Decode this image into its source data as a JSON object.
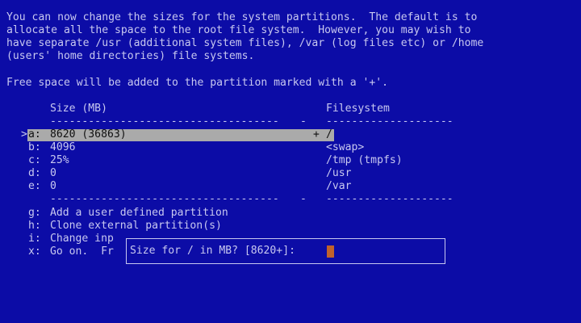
{
  "intro": [
    "You can now change the sizes for the system partitions.  The default is to",
    "allocate all the space to the root file system.  However, you may wish to",
    "have separate /usr (additional system files), /var (log files etc) or /home",
    "(users' home directories) file systems."
  ],
  "free_space_note": "Free space will be added to the partition marked with a '+'.",
  "table": {
    "header_size": "Size (MB)",
    "header_fs": "Filesystem",
    "rule_size": "------------------------------------",
    "rule_mid": "-",
    "rule_fs": "--------------------",
    "selector": ">",
    "rows": [
      {
        "key": "a:",
        "size": "8620 (36863)",
        "flag": "+",
        "fs": "/"
      },
      {
        "key": "b:",
        "size": "4096",
        "flag": "",
        "fs": "<swap>"
      },
      {
        "key": "c:",
        "size": "25%",
        "flag": "",
        "fs": "/tmp (tmpfs)"
      },
      {
        "key": "d:",
        "size": "0",
        "flag": "",
        "fs": "/usr"
      },
      {
        "key": "e:",
        "size": "0",
        "flag": "",
        "fs": "/var"
      }
    ]
  },
  "options": [
    {
      "key": "g:",
      "label": "Add a user defined partition"
    },
    {
      "key": "h:",
      "label": "Clone external partition(s)"
    },
    {
      "key": "i:",
      "label": "Change inp"
    },
    {
      "key": "x:",
      "label": "Go on.  Fr"
    }
  ],
  "dialog": {
    "prompt": "Size for / in MB? [8620+]:"
  },
  "colors": {
    "background": "#0c0ca6",
    "text": "#c8c8f0",
    "highlight": "#aaaaaa",
    "cursor": "#c0622c"
  }
}
